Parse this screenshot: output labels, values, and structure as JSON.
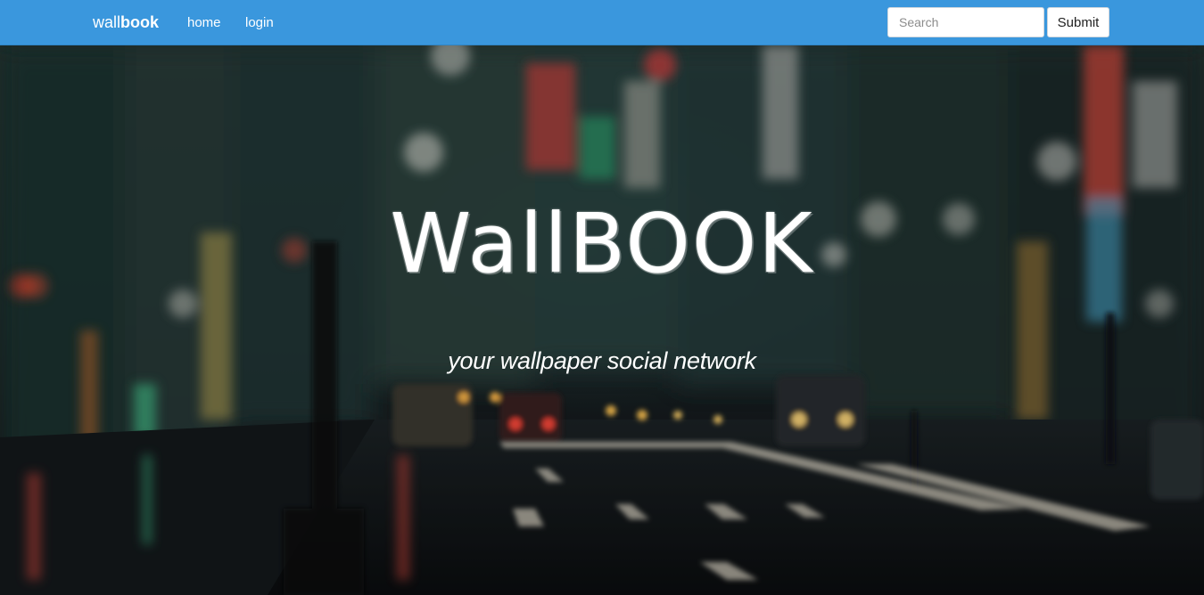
{
  "navbar": {
    "brand_light": "wall",
    "brand_bold": "book",
    "links": [
      {
        "label": "home"
      },
      {
        "label": "login"
      }
    ],
    "search": {
      "value": "",
      "placeholder": "Search"
    },
    "submit_label": "Submit",
    "background_color": "#3a97dd"
  },
  "hero": {
    "title": "WallBOOK",
    "subtitle": "your wallpaper social network",
    "background_image": "blurred-night-city-street-photo"
  }
}
